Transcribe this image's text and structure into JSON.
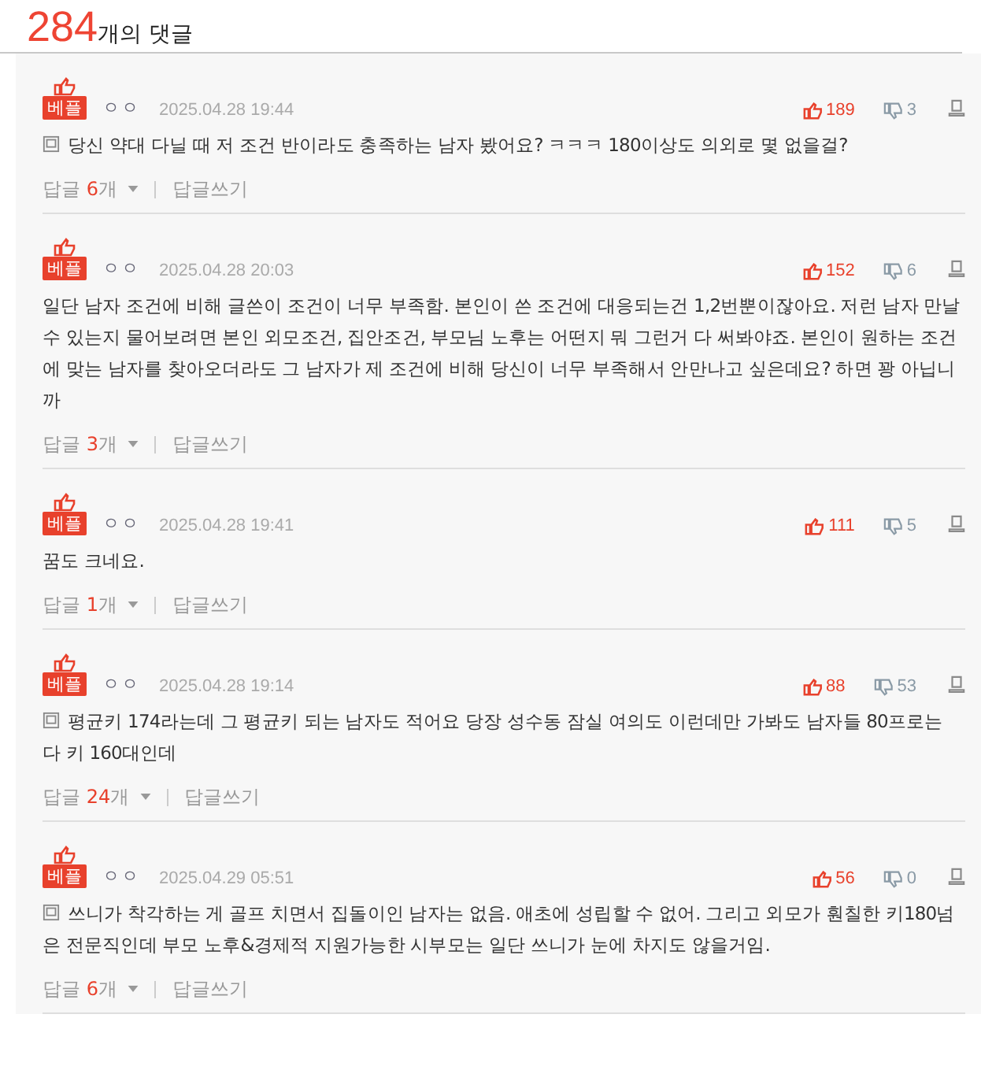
{
  "header": {
    "count": "284",
    "label": "개의 댓글"
  },
  "comments": [
    {
      "badge": "베플",
      "author": "ㅇㅇ",
      "date": "2025.04.28 19:44",
      "likes": "189",
      "dislikes": "3",
      "memo_icon": true,
      "text": "당신 약대 다닐 때 저 조건 반이라도 충족하는 남자 봤어요? ㅋㅋㅋ 180이상도 의외로 몇 없을걸?",
      "replies": {
        "label": "답글",
        "count": "6",
        "unit": "개"
      },
      "write": "답글쓰기"
    },
    {
      "badge": "베플",
      "author": "ㅇㅇ",
      "date": "2025.04.28 20:03",
      "likes": "152",
      "dislikes": "6",
      "memo_icon": false,
      "text": "일단 남자 조건에 비해 글쓴이 조건이 너무 부족함. 본인이 쓴 조건에 대응되는건 1,2번뿐이잖아요. 저런 남자 만날 수 있는지 물어보려면 본인 외모조건, 집안조건, 부모님 노후는 어떤지 뭐 그런거 다 써봐야죠. 본인이 원하는 조건에 맞는 남자를 찾아오더라도 그 남자가 제 조건에 비해 당신이 너무 부족해서 안만나고 싶은데요? 하면 꽝 아닙니까",
      "replies": {
        "label": "답글",
        "count": "3",
        "unit": "개"
      },
      "write": "답글쓰기"
    },
    {
      "badge": "베플",
      "author": "ㅇㅇ",
      "date": "2025.04.28 19:41",
      "likes": "111",
      "dislikes": "5",
      "memo_icon": false,
      "text": "꿈도 크네요.",
      "replies": {
        "label": "답글",
        "count": "1",
        "unit": "개"
      },
      "write": "답글쓰기"
    },
    {
      "badge": "베플",
      "author": "ㅇㅇ",
      "date": "2025.04.28 19:14",
      "likes": "88",
      "dislikes": "53",
      "memo_icon": true,
      "text": "평균키 174라는데 그 평균키 되는 남자도 적어요 당장 성수동 잠실 여의도 이런데만 가봐도 남자들 80프로는 다 키 160대인데",
      "replies": {
        "label": "답글",
        "count": "24",
        "unit": "개"
      },
      "write": "답글쓰기"
    },
    {
      "badge": "베플",
      "author": "ㅇㅇ",
      "date": "2025.04.29 05:51",
      "likes": "56",
      "dislikes": "0",
      "memo_icon": true,
      "text": "쓰니가 착각하는 게 골프 치면서 집돌이인 남자는 없음. 애초에 성립할 수 없어. 그리고 외모가 훤칠한 키180넘은 전문직인데 부모 노후&경제적 지원가능한 시부모는 일단 쓰니가 눈에 차지도 않을거임.",
      "replies": {
        "label": "답글",
        "count": "6",
        "unit": "개"
      },
      "write": "답글쓰기"
    }
  ]
}
